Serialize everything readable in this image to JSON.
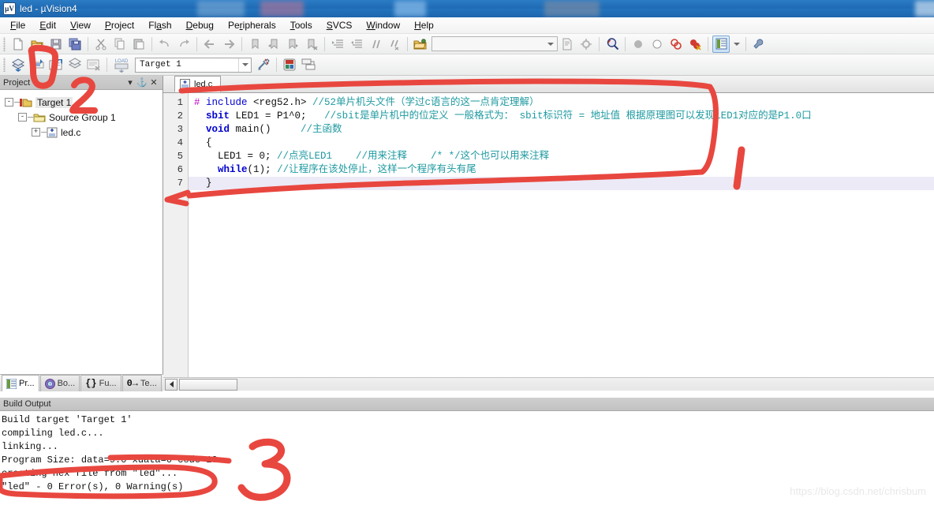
{
  "window": {
    "title": "led  - µVision4",
    "app_icon": "uvision-icon"
  },
  "menubar": {
    "items": [
      {
        "label": "File",
        "accel": "F"
      },
      {
        "label": "Edit",
        "accel": "E"
      },
      {
        "label": "View",
        "accel": "V"
      },
      {
        "label": "Project",
        "accel": "P"
      },
      {
        "label": "Flash",
        "accel": "a"
      },
      {
        "label": "Debug",
        "accel": "D"
      },
      {
        "label": "Peripherals",
        "accel": "r"
      },
      {
        "label": "Tools",
        "accel": "T"
      },
      {
        "label": "SVCS",
        "accel": "S"
      },
      {
        "label": "Window",
        "accel": "W"
      },
      {
        "label": "Help",
        "accel": "H"
      }
    ]
  },
  "toolbar_main": {
    "buttons": [
      {
        "name": "new-file-icon"
      },
      {
        "name": "open-file-icon"
      },
      {
        "name": "save-icon"
      },
      {
        "name": "save-all-icon"
      },
      {
        "name": "cut-icon"
      },
      {
        "name": "copy-icon"
      },
      {
        "name": "paste-icon"
      },
      {
        "name": "undo-icon"
      },
      {
        "name": "redo-icon"
      },
      {
        "name": "navigate-back-icon"
      },
      {
        "name": "navigate-forward-icon"
      },
      {
        "name": "bookmark-toggle-icon"
      },
      {
        "name": "bookmark-prev-icon"
      },
      {
        "name": "bookmark-next-icon"
      },
      {
        "name": "bookmark-clear-icon"
      },
      {
        "name": "indent-icon"
      },
      {
        "name": "outdent-icon"
      },
      {
        "name": "comment-icon"
      },
      {
        "name": "uncomment-icon"
      },
      {
        "name": "open-project-folder-icon"
      }
    ],
    "find_combo_value": "",
    "find_combo_placeholder": "",
    "extra_buttons": [
      {
        "name": "find-in-files-icon"
      },
      {
        "name": "configure-icon"
      },
      {
        "name": "find-icon"
      },
      {
        "name": "breakpoint-filled-icon"
      },
      {
        "name": "breakpoint-empty-icon"
      },
      {
        "name": "breakpoint-disable-all-icon"
      },
      {
        "name": "breakpoint-kill-all-icon"
      },
      {
        "name": "project-window-icon"
      },
      {
        "name": "project-window-dropdown-icon"
      },
      {
        "name": "configure-wizard-icon"
      }
    ]
  },
  "toolbar_build": {
    "buttons": [
      {
        "name": "translate-icon"
      },
      {
        "name": "build-icon"
      },
      {
        "name": "rebuild-all-icon"
      },
      {
        "name": "batch-build-icon"
      },
      {
        "name": "stop-build-icon"
      },
      {
        "name": "download-to-flash-icon"
      }
    ],
    "target_label": "Target 1",
    "after_buttons": [
      {
        "name": "target-options-icon"
      },
      {
        "name": "manage-components-icon"
      },
      {
        "name": "manage-multiproject-icon"
      }
    ]
  },
  "project_panel": {
    "title": "Project",
    "window_buttons": [
      {
        "name": "panel-menu-icon",
        "glyph": "▾"
      },
      {
        "name": "panel-pin-icon",
        "glyph": "⚑"
      },
      {
        "name": "panel-close-icon",
        "glyph": "✕"
      }
    ],
    "tree": [
      {
        "label": "Target 1",
        "icon": "target-icon",
        "expander": "-",
        "level": 0,
        "selected": true
      },
      {
        "label": "Source Group 1",
        "icon": "folder-icon",
        "expander": "-",
        "level": 1,
        "selected": false
      },
      {
        "label": "led.c",
        "icon": "c-file-icon",
        "expander": "+",
        "level": 2,
        "selected": false
      }
    ],
    "tabs": [
      {
        "label": "Pr...",
        "icon": "project-icon",
        "active": true
      },
      {
        "label": "Bo...",
        "icon": "books-icon",
        "active": false
      },
      {
        "label": "Fu...",
        "icon": "functions-icon",
        "active": false
      },
      {
        "label": "Te...",
        "icon": "templates-icon",
        "active": false
      }
    ]
  },
  "editor": {
    "tabs": [
      {
        "label": "led.c",
        "icon": "c-file-icon",
        "active": true
      }
    ],
    "line_numbers": [
      "1",
      "2",
      "3",
      "4",
      "5",
      "6",
      "7"
    ],
    "current_line": 7,
    "lines": [
      {
        "n": 1,
        "tokens": [
          {
            "t": "#",
            "c": "pre"
          },
          {
            "t": " include ",
            "c": "inc"
          },
          {
            "t": "<reg52.h> ",
            "c": "txt"
          },
          {
            "t": "//52单片机头文件（学过c语言的这一点肯定理解）",
            "c": "cm"
          }
        ]
      },
      {
        "n": 2,
        "tokens": [
          {
            "t": "  ",
            "c": "txt"
          },
          {
            "t": "sbit",
            "c": "kw"
          },
          {
            "t": " LED1 = P1^0;   ",
            "c": "txt"
          },
          {
            "t": "//sbit是单片机中的位定义 一般格式为： sbit标识符 = 地址值 根据原理图可以发现LED1对应的是P1.0口",
            "c": "cm"
          }
        ]
      },
      {
        "n": 3,
        "tokens": [
          {
            "t": "  ",
            "c": "txt"
          },
          {
            "t": "void",
            "c": "kw"
          },
          {
            "t": " main()     ",
            "c": "txt"
          },
          {
            "t": "//主函数",
            "c": "cm"
          }
        ]
      },
      {
        "n": 4,
        "tokens": [
          {
            "t": "  {",
            "c": "txt"
          }
        ]
      },
      {
        "n": 5,
        "tokens": [
          {
            "t": "    LED1 = ",
            "c": "txt"
          },
          {
            "t": "0",
            "c": "num"
          },
          {
            "t": "; ",
            "c": "txt"
          },
          {
            "t": "//点亮LED1    //用来注释    /* */这个也可以用来注释",
            "c": "cm"
          }
        ]
      },
      {
        "n": 6,
        "tokens": [
          {
            "t": "    ",
            "c": "txt"
          },
          {
            "t": "while",
            "c": "kw"
          },
          {
            "t": "(",
            "c": "txt"
          },
          {
            "t": "1",
            "c": "num"
          },
          {
            "t": "); ",
            "c": "txt"
          },
          {
            "t": "//让程序在该处停止，这样一个程序有头有尾",
            "c": "cm"
          }
        ]
      },
      {
        "n": 7,
        "tokens": [
          {
            "t": "  }",
            "c": "txt"
          }
        ]
      }
    ]
  },
  "build_output": {
    "title": "Build Output",
    "lines": [
      "Build target 'Target 1'",
      "compiling led.c...",
      "linking...",
      "Program Size: data=9.0 xdata=0 code=19",
      "creating hex file from \"led\"...",
      "\"led\" - 0 Error(s), 0 Warning(s)"
    ]
  },
  "annotations": {
    "marker_1_label": "1",
    "marker_2_label": "2",
    "marker_3_label": "3",
    "color": "#e8473f"
  },
  "watermark": {
    "text": "https://blog.csdn.net/chrisbum"
  }
}
